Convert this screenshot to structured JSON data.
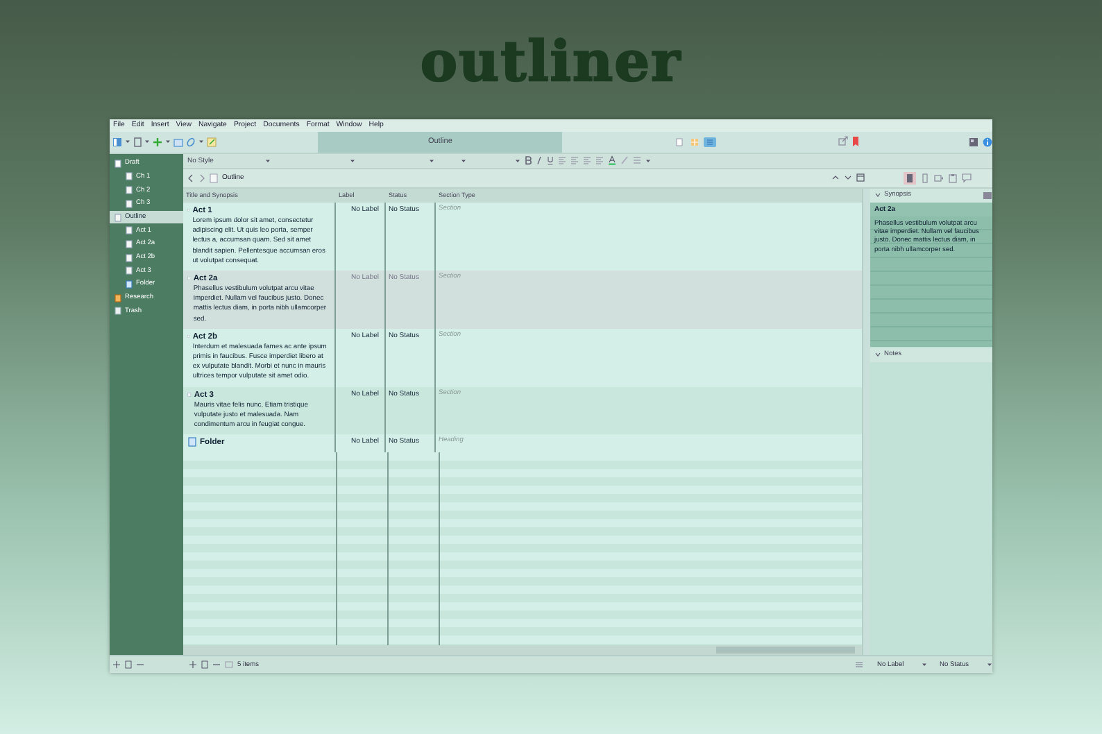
{
  "banner": {
    "title": "outliner"
  },
  "menu": [
    "File",
    "Edit",
    "Insert",
    "View",
    "Navigate",
    "Project",
    "Documents",
    "Format",
    "Window",
    "Help"
  ],
  "toolbar": {
    "title": "Outline",
    "view_modes": [
      {
        "kind": "scrivenings",
        "selected": false
      },
      {
        "kind": "corkboard",
        "selected": false
      },
      {
        "kind": "outliner",
        "selected": true
      }
    ]
  },
  "format_bar": {
    "style": "No Style"
  },
  "binder": [
    {
      "label": "Draft",
      "kind": "draft",
      "selected": false,
      "children": [
        {
          "label": "Ch 1",
          "kind": "document",
          "selected": false
        },
        {
          "label": "Ch 2",
          "kind": "document",
          "selected": false
        },
        {
          "label": "Ch 3",
          "kind": "document",
          "selected": false
        }
      ]
    },
    {
      "label": "Outline",
      "kind": "document",
      "selected": true,
      "children": [
        {
          "label": "Act 1",
          "kind": "document",
          "selected": false
        },
        {
          "label": "Act 2a",
          "kind": "document",
          "selected": false
        },
        {
          "label": "Act 2b",
          "kind": "document",
          "selected": false
        },
        {
          "label": "Act 3",
          "kind": "document",
          "selected": false
        },
        {
          "label": "Folder",
          "kind": "folder",
          "selected": false
        }
      ]
    },
    {
      "label": "Research",
      "kind": "research",
      "selected": false
    },
    {
      "label": "Trash",
      "kind": "trash",
      "selected": false
    }
  ],
  "outline": {
    "header": "Outline",
    "columns": [
      "Title and Synopsis",
      "Label",
      "Status",
      "Section Type"
    ],
    "rows": [
      {
        "kind": "document",
        "title": "Act 1",
        "synopsis": "Lorem ipsum dolor sit amet, consectetur adipiscing elit. Ut quis leo porta, semper lectus a, accumsan quam. Sed sit amet blandit sapien. Pellentesque accumsan eros ut volutpat consequat.",
        "label": "No Label",
        "status": "No Status",
        "section_type": "Section",
        "selected": false
      },
      {
        "kind": "document",
        "title": "Act 2a",
        "synopsis": "Phasellus vestibulum volutpat arcu vitae imperdiet. Nullam vel faucibus justo. Donec mattis lectus diam, in porta nibh ullamcorper sed.",
        "label": "No Label",
        "status": "No Status",
        "section_type": "Section",
        "selected": true
      },
      {
        "kind": "document",
        "title": "Act 2b",
        "synopsis": "Interdum et malesuada fames ac ante ipsum primis in faucibus. Fusce imperdiet libero at ex vulputate blandit. Morbi et nunc in mauris ultrices tempor vulputate sit amet odio.",
        "label": "No Label",
        "status": "No Status",
        "section_type": "Section",
        "selected": false
      },
      {
        "kind": "document",
        "title": "Act 3",
        "synopsis": "Mauris vitae felis nunc. Etiam tristique vulputate justo et malesuada. Nam condimentum arcu in feugiat congue.",
        "label": "No Label",
        "status": "No Status",
        "section_type": "Section",
        "selected": false
      },
      {
        "kind": "folder",
        "title": "Folder",
        "label": "No Label",
        "status": "No Status",
        "section_type": "Heading",
        "selected": false
      }
    ],
    "count": "5 items"
  },
  "inspector": {
    "synopsis_header": "Synopsis",
    "title": "Act 2a",
    "synopsis": "Phasellus vestibulum volutpat arcu vitae imperdiet. Nullam vel faucibus justo. Donec mattis lectus diam, in porta nibh ullamcorper sed.",
    "notes_header": "Notes"
  },
  "footer": {
    "label": "No Label",
    "status": "No Status"
  }
}
